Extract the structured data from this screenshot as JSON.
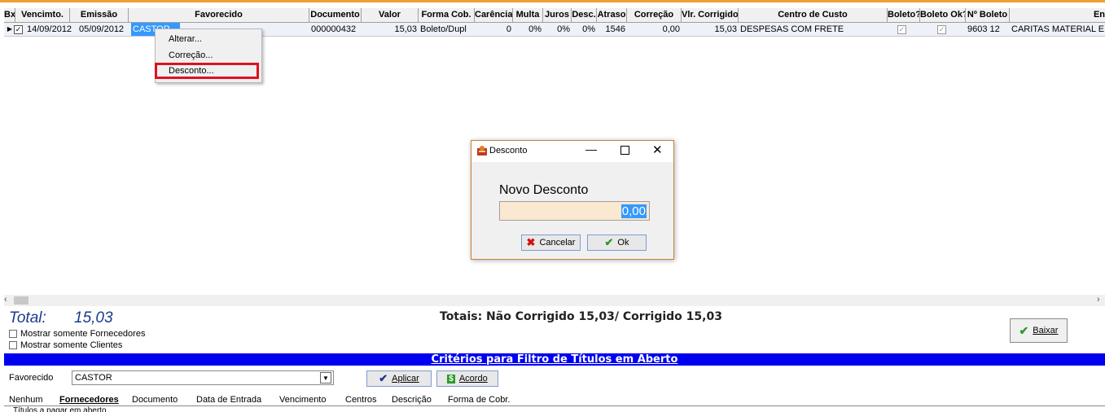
{
  "grid": {
    "headers": [
      "Bx",
      "Vencimto.",
      "Emissão",
      "Favorecido",
      "Documento",
      "Valor",
      "Forma Cob.",
      "Carência",
      "Multa",
      "Juros",
      "Desc.",
      "Atraso",
      "Correção",
      "Vlr. Corrigido",
      "Centro de Custo",
      "Boleto?",
      "Boleto Ok?",
      "Nº Boleto",
      "En"
    ],
    "row": {
      "vencimento": "14/09/2012",
      "emissao": "05/09/2012",
      "favorecido": "CASTOR",
      "documento": "000000432",
      "valor": "15,03",
      "forma_cob": "Boleto/Dupl",
      "carencia": "0",
      "multa": "0%",
      "juros": "0%",
      "desc": "0%",
      "atraso": "1546",
      "correcao": "0,00",
      "vlr_corrigido": "15,03",
      "centro_custo": "DESPESAS COM FRETE",
      "n_boleto": "9603 12",
      "endereco": "CARITAS MATERIAL EL"
    }
  },
  "context_menu": {
    "items": [
      "Alterar...",
      "Correção...",
      "Desconto..."
    ]
  },
  "dialog": {
    "title": "Desconto",
    "label": "Novo Desconto",
    "value": "0,00",
    "cancel_label": "Cancelar",
    "ok_label": "Ok"
  },
  "totals": {
    "label": "Total:",
    "value": "15,03",
    "summary": "Totais: Não Corrigido 15,03/ Corrigido 15,03"
  },
  "options": {
    "only_suppliers": "Mostrar somente Fornecedores",
    "only_clients": "Mostrar somente Clientes"
  },
  "actions": {
    "baixar_label": "Baixar"
  },
  "filter": {
    "title": "Critérios para Filtro de Títulos em Aberto",
    "favorecido_label": "Favorecido",
    "favorecido_value": "CASTOR",
    "aplicar_label": "Aplicar",
    "acordo_label": "Acordo"
  },
  "tabs": [
    "Nenhum",
    "Fornecedores",
    "Documento",
    "Data de Entrada",
    "Vencimento",
    "Centros",
    "Descrição",
    "Forma de Cobr."
  ],
  "footer_text": "Títulos a pagar em aberto",
  "colors": {
    "accent_blue": "#0000f0",
    "total_blue": "#1a3a8a",
    "highlight_red": "#e01020",
    "input_bg": "#fae8d0"
  }
}
